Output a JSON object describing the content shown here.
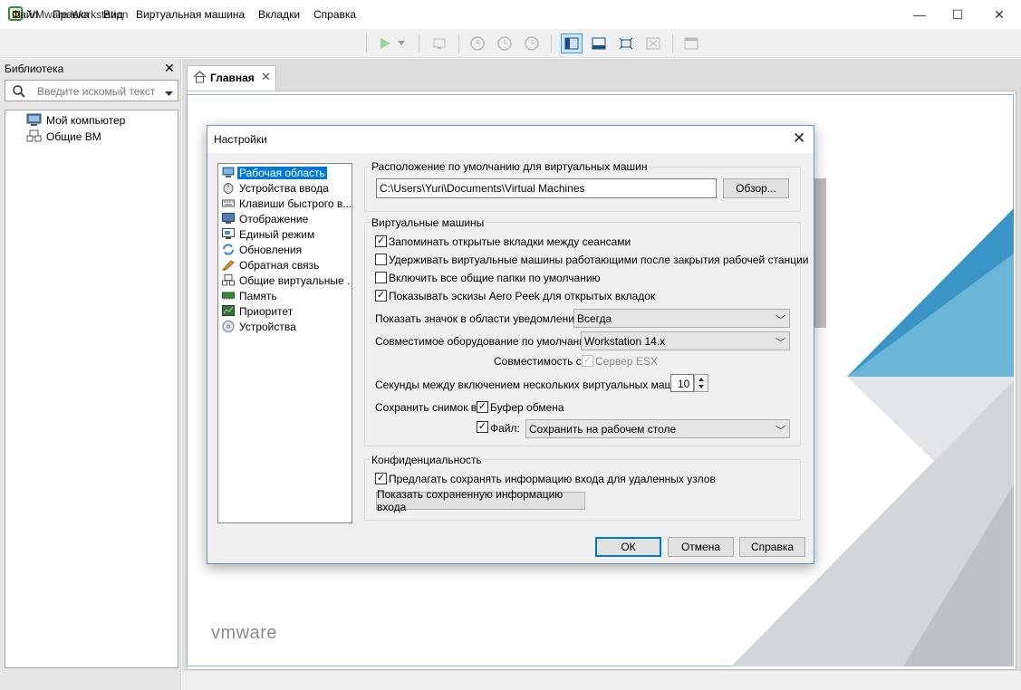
{
  "window": {
    "title": "VMware Workstation",
    "minimize": "—",
    "maximize": "☐",
    "close": "✕"
  },
  "menu": {
    "file": "Файл",
    "edit": "Правка",
    "view": "Вид",
    "vm": "Виртуальная машина",
    "tabs": "Вкладки",
    "help": "Справка"
  },
  "library": {
    "title": "Библиотека",
    "close": "✕",
    "search_placeholder": "Введите искомый текст",
    "items": [
      {
        "label": "Мой компьютер",
        "icon": "computer-icon"
      },
      {
        "label": "Общие ВМ",
        "icon": "shared-vm-icon"
      }
    ]
  },
  "tab": {
    "label": "Главная",
    "close": "✕"
  },
  "brand": {
    "logo_text": "vmware"
  },
  "dialog": {
    "title": "Настройки",
    "close": "✕",
    "nav": [
      {
        "label": "Рабочая область",
        "selected": true
      },
      {
        "label": "Устройства ввода"
      },
      {
        "label": "Клавиши быстрого в..."
      },
      {
        "label": "Отображение"
      },
      {
        "label": "Единый режим"
      },
      {
        "label": "Обновления"
      },
      {
        "label": "Обратная связь"
      },
      {
        "label": "Общие виртуальные ..."
      },
      {
        "label": "Память"
      },
      {
        "label": "Приоритет"
      },
      {
        "label": "Устройства"
      }
    ],
    "location": {
      "group_title": "Расположение по умолчанию для виртуальных машин",
      "path": "C:\\Users\\Yuri\\Documents\\Virtual Machines",
      "browse": "Обзор..."
    },
    "vms": {
      "group_title": "Виртуальные машины",
      "opt_remember_tabs": "Запоминать открытые вкладки между сеансами",
      "opt_keep_running": "Удерживать виртуальные машины работающими после закрытия рабочей станции",
      "opt_shared_folders": "Включить все общие папки по умолчанию",
      "opt_aero_peek": "Показывать эскизы Aero Peek для открытых вкладок",
      "tray_label": "Показать значок в области уведомлений:",
      "tray_value": "Всегда",
      "hw_label": "Совместимое оборудование по умолчанию:",
      "hw_value": "Workstation 14.x",
      "compat_label": "Совместимость с:",
      "compat_esx": "Сервер ESX",
      "delay_label": "Секунды между включением нескольких виртуальных машин:",
      "delay_value": "10",
      "snapshot_label": "Сохранить снимок в:",
      "clipboard": "Буфер обмена",
      "file_label": "Файл:",
      "file_value": "Сохранить на рабочем столе"
    },
    "privacy": {
      "group_title": "Конфиденциальность",
      "opt_save_login": "Предлагать сохранять информацию входа для удаленных узлов",
      "show_button": "Показать сохраненную информацию входа"
    },
    "buttons": {
      "ok": "ОК",
      "cancel": "Отмена",
      "help": "Справка"
    }
  },
  "colors": {
    "accent": "#0078d7",
    "vmware_blue": "#2f8fc4",
    "triangle_gray": "#cfd3d6"
  }
}
